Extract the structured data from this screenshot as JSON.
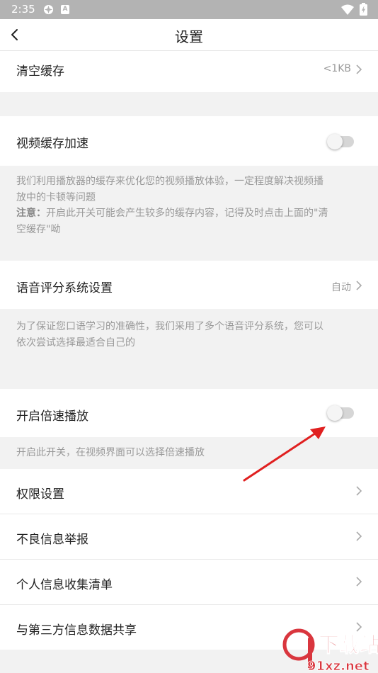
{
  "status_bar": {
    "time": "2:35",
    "notif_icon_2": "A"
  },
  "nav": {
    "title": "设置"
  },
  "rows": {
    "clear_cache": {
      "label": "清空缓存",
      "value": "<1KB"
    },
    "video_cache": {
      "label": "视频缓存加速",
      "toggle_on": false
    },
    "voice_eval": {
      "label": "语音评分系统设置",
      "value": "自动"
    },
    "speed_play": {
      "label": "开启倍速播放",
      "toggle_on": false
    },
    "permissions": {
      "label": "权限设置"
    },
    "report": {
      "label": "不良信息举报"
    },
    "personal_info": {
      "label": "个人信息收集清单"
    },
    "third_party": {
      "label": "与第三方信息数据共享"
    }
  },
  "descriptions": {
    "video_cache_line1": "我们利用播放器的缓存来优化您的视频播放体验，一定程度解决视频播",
    "video_cache_line2": "放中的卡顿等问题",
    "video_cache_note_prefix": "注意：",
    "video_cache_note_line1": "开启此开关可能会产生较多的缓存内容，记得及时点击上面的\"清",
    "video_cache_note_line2": "空缓存\"呦",
    "voice_eval_line1": "为了保证您口语学习的准确性，我们采用了多个语音评分系统，您可以",
    "voice_eval_line2": "依次尝试选择最适合自己的",
    "speed_play": "开启此开关，在视频界面可以选择倍速播放"
  },
  "watermark": {
    "text_top": "下载站",
    "text_bottom": "91xz.net"
  },
  "colors": {
    "arrow": "#e02020",
    "watermark": "#d9363e",
    "toggle_track": "#d6d6d6"
  }
}
